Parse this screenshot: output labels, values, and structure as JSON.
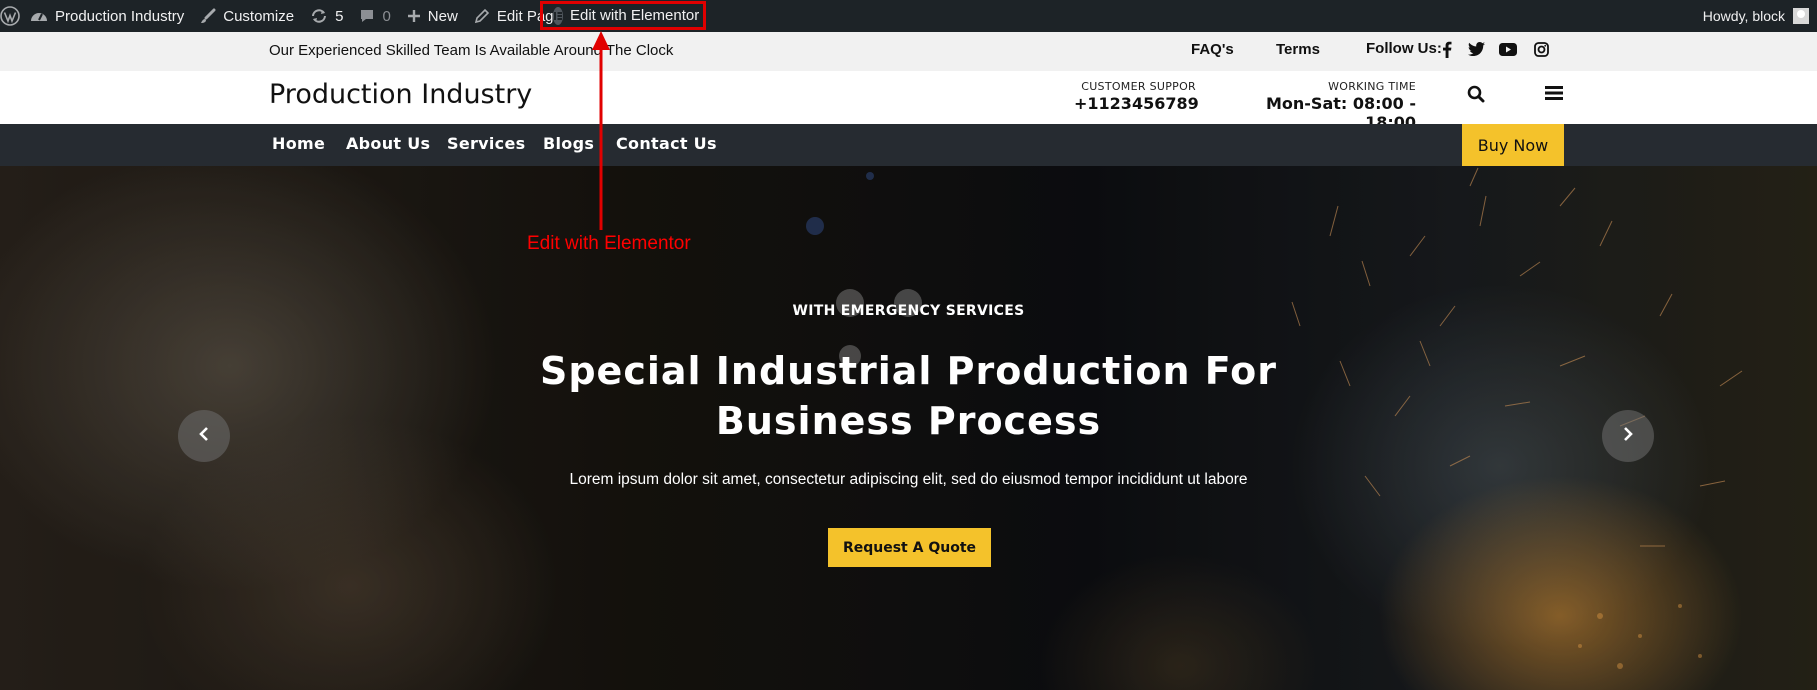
{
  "adminbar": {
    "site_name": "Production Industry",
    "customize": "Customize",
    "updates_count": "5",
    "comments_count": "0",
    "new": "New",
    "edit_page": "Edit Page",
    "edit_elementor": "Edit with Elementor",
    "greeting": "Howdy, block"
  },
  "topbar": {
    "tagline": "Our Experienced Skilled Team Is Available Around The Clock",
    "faq": "FAQ's",
    "terms": "Terms",
    "follow_label": "Follow Us:",
    "social_icons": [
      "facebook-icon",
      "twitter-icon",
      "youtube-icon",
      "instagram-icon"
    ]
  },
  "header": {
    "site_title": "Production Industry",
    "support_caption": "CUSTOMER SUPPOR",
    "support_phone": "+1123456789",
    "working_caption": "WORKING TIME",
    "working_hours": "Mon-Sat: 08:00 - 18:00"
  },
  "nav": {
    "items": [
      "Home",
      "About Us",
      "Services",
      "Blogs",
      "Contact Us"
    ],
    "buy_now": "Buy Now"
  },
  "hero": {
    "kicker": "WITH EMERGENCY SERVICES",
    "title_line1": "Special Industrial Production For",
    "title_line2": "Business Process",
    "text": "Lorem ipsum dolor sit amet, consectetur adipiscing elit, sed do eiusmod tempor incididunt ut labore",
    "button": "Request A Quote"
  },
  "annotation": {
    "label": "Edit with Elementor"
  },
  "colors": {
    "admin_bg": "#1d2327",
    "accent_yellow": "#f4c22b",
    "nav_bg": "#262b31",
    "annotation_red": "#e10000"
  }
}
